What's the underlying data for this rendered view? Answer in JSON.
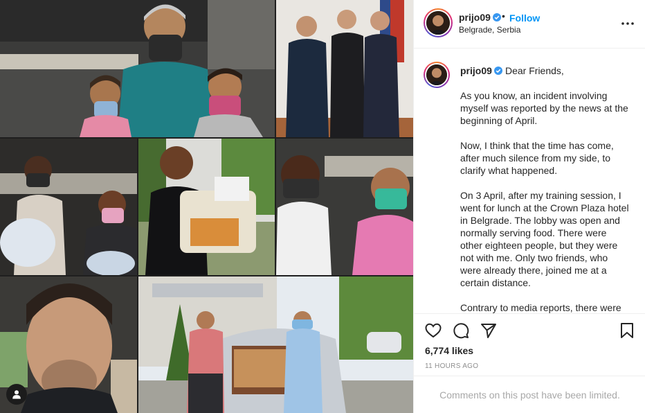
{
  "post": {
    "username": "prijo09",
    "separator": "•",
    "follow_label": "Follow",
    "location": "Belgrade, Serbia",
    "caption_first_line": "Dear Friends,",
    "caption_paragraphs": [
      "As you know, an incident involving myself was reported by the news at the beginning of April.",
      "Now, I think that the time has come, after much silence from my side, to clarify what happened.",
      "On 3 April, after my training session, I went for lunch at the Crown Plaza hotel in Belgrade. The lobby was open and normally serving food. There were other eighteen people, but they were not with me. Only two friends, who were already there, joined me at a certain distance.",
      "Contrary to media reports, there were"
    ],
    "likes": "6,774 likes",
    "timestamp": "11 HOURS AGO",
    "comments_notice": "Comments on this post have been limited."
  },
  "icons": {
    "verified": "verified-badge-icon",
    "more": "more-options-icon",
    "like": "heart-icon",
    "comment": "comment-bubble-icon",
    "share": "paper-plane-icon",
    "save": "bookmark-icon",
    "tags": "user-tag-icon"
  },
  "colors": {
    "accent": "#0095f6",
    "verified": "#3897f0",
    "muted": "#8e8e8e",
    "border": "#efefef"
  }
}
